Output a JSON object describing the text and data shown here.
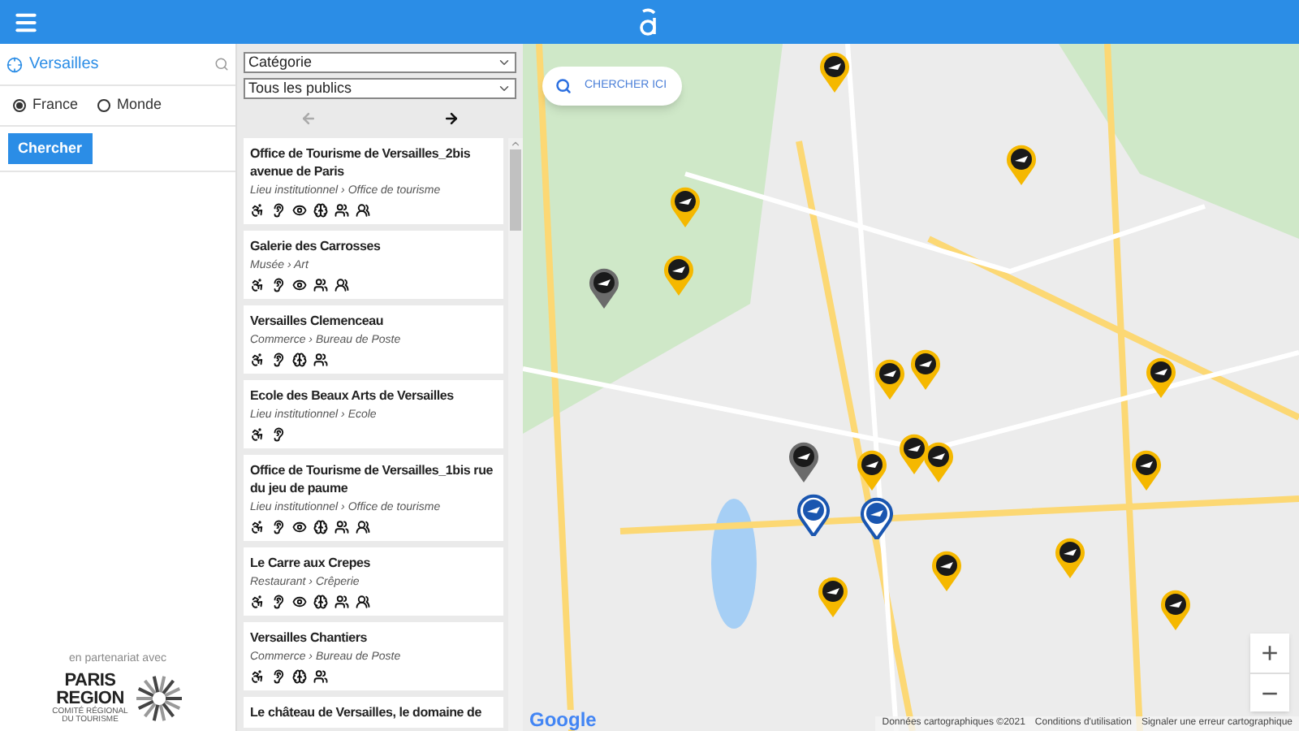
{
  "search": {
    "value": "Versailles"
  },
  "scope": [
    {
      "label": "France",
      "selected": true
    },
    {
      "label": "Monde",
      "selected": false
    }
  ],
  "search_button": "Chercher",
  "partner": {
    "caption": "en partenariat avec",
    "line_1": "PARIS",
    "line_2": "REGION",
    "line_3": "COMITÉ RÉGIONAL",
    "line_4": "DU TOURISME"
  },
  "filters": [
    {
      "value": "Catégorie"
    },
    {
      "value": "Tous les publics"
    }
  ],
  "pager": {
    "prev_disabled": true,
    "next_disabled": false
  },
  "results": [
    {
      "title": "Office de Tourisme de Versailles_2bis avenue de Paris",
      "category": "Lieu institutionnel › Office de tourisme",
      "access": {
        "wheelchair": true,
        "hearing": true,
        "visual": true,
        "mental": true,
        "family": true,
        "group": true
      }
    },
    {
      "title": "Galerie des Carrosses",
      "category": "Musée › Art",
      "access": {
        "wheelchair": true,
        "hearing": true,
        "visual": true,
        "mental": false,
        "family": true,
        "group": true
      }
    },
    {
      "title": "Versailles Clemenceau",
      "category": "Commerce › Bureau de Poste",
      "access": {
        "wheelchair": true,
        "hearing": true,
        "visual": false,
        "mental": true,
        "family": true,
        "group": false
      }
    },
    {
      "title": "Ecole des Beaux Arts de Versailles",
      "category": "Lieu institutionnel › Ecole",
      "access": {
        "wheelchair": true,
        "hearing": true,
        "visual": false,
        "mental": false,
        "family": false,
        "group": false
      }
    },
    {
      "title": "Office de Tourisme de Versailles_1bis rue du jeu de paume",
      "category": "Lieu institutionnel › Office de tourisme",
      "access": {
        "wheelchair": true,
        "hearing": true,
        "visual": true,
        "mental": true,
        "family": true,
        "group": true
      }
    },
    {
      "title": "Le Carre aux Crepes",
      "category": "Restaurant › Crêperie",
      "access": {
        "wheelchair": true,
        "hearing": true,
        "visual": true,
        "mental": true,
        "family": true,
        "group": true
      }
    },
    {
      "title": "Versailles Chantiers",
      "category": "Commerce › Bureau de Poste",
      "access": {
        "wheelchair": true,
        "hearing": true,
        "visual": false,
        "mental": true,
        "family": true,
        "group": false
      }
    },
    {
      "title": "Le château de Versailles, le domaine de"
    }
  ],
  "map": {
    "search_here": "CHERCHER ICI",
    "logo": "Google",
    "footer": [
      "Données cartographiques ©2021",
      "Conditions d'utilisation",
      "Signaler une erreur cartographique"
    ],
    "zoom_in": "+",
    "zoom_out": "−"
  }
}
